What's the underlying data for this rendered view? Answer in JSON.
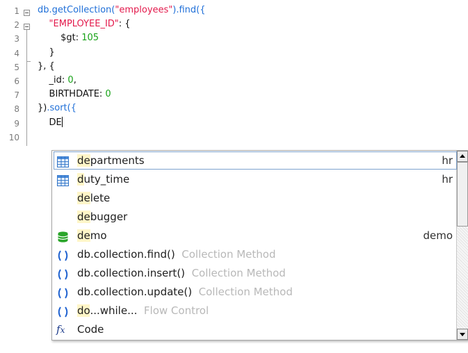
{
  "editor": {
    "line_numbers": [
      "1",
      "2",
      "3",
      "4",
      "5",
      "6",
      "7",
      "8",
      "9",
      "10"
    ],
    "lines": [
      [
        {
          "t": "db",
          "c": "c-blue"
        },
        {
          "t": ".getCollection(",
          "c": "c-blue"
        },
        {
          "t": "\"employees\"",
          "c": "c-red"
        },
        {
          "t": ").find({",
          "c": "c-blue"
        }
      ],
      [
        {
          "t": "    ",
          "c": ""
        },
        {
          "t": "\"EMPLOYEE_ID\"",
          "c": "c-red"
        },
        {
          "t": ": {",
          "c": "c-black"
        }
      ],
      [
        {
          "t": "        ",
          "c": ""
        },
        {
          "t": "$gt",
          "c": "c-black"
        },
        {
          "t": ": ",
          "c": "c-black"
        },
        {
          "t": "105",
          "c": "c-green"
        }
      ],
      [
        {
          "t": "    }",
          "c": "c-black"
        }
      ],
      [
        {
          "t": "}, {",
          "c": "c-black"
        }
      ],
      [
        {
          "t": "    _id",
          "c": "c-black"
        },
        {
          "t": ": ",
          "c": "c-black"
        },
        {
          "t": "0",
          "c": "c-green"
        },
        {
          "t": ",",
          "c": "c-black"
        }
      ],
      [
        {
          "t": "    BIRTHDATE",
          "c": "c-black"
        },
        {
          "t": ": ",
          "c": "c-black"
        },
        {
          "t": "0",
          "c": "c-green"
        }
      ],
      [
        {
          "t": "})",
          "c": "c-black"
        },
        {
          "t": ".sort({",
          "c": "c-blue"
        }
      ],
      [
        {
          "t": "    DE",
          "c": "c-black"
        }
      ]
    ]
  },
  "autocomplete": {
    "items": [
      {
        "icon": "table-icon",
        "hl": "de",
        "rest": "partments",
        "meta": "hr",
        "desc": ""
      },
      {
        "icon": "table-icon",
        "hl": "d",
        "rest": "uty_time",
        "meta": "hr",
        "desc": ""
      },
      {
        "icon": "",
        "hl": "de",
        "rest": "lete",
        "meta": "",
        "desc": ""
      },
      {
        "icon": "",
        "hl": "de",
        "rest": "bugger",
        "meta": "",
        "desc": ""
      },
      {
        "icon": "database-icon",
        "hl": "de",
        "rest": "mo",
        "meta": "demo",
        "desc": ""
      },
      {
        "icon": "method-icon",
        "hl": "",
        "rest": "db.collection.find()",
        "meta": "",
        "desc": "Collection Method"
      },
      {
        "icon": "method-icon",
        "hl": "",
        "rest": "db.collection.insert()",
        "meta": "",
        "desc": "Collection Method"
      },
      {
        "icon": "method-icon",
        "hl": "",
        "rest": "db.collection.update()",
        "meta": "",
        "desc": "Collection Method"
      },
      {
        "icon": "method-icon",
        "hl": "do",
        "rest": "...while...",
        "meta": "",
        "desc": "Flow Control"
      },
      {
        "icon": "function-icon",
        "hl": "",
        "rest": "Code",
        "meta": "",
        "desc": ""
      }
    ]
  }
}
